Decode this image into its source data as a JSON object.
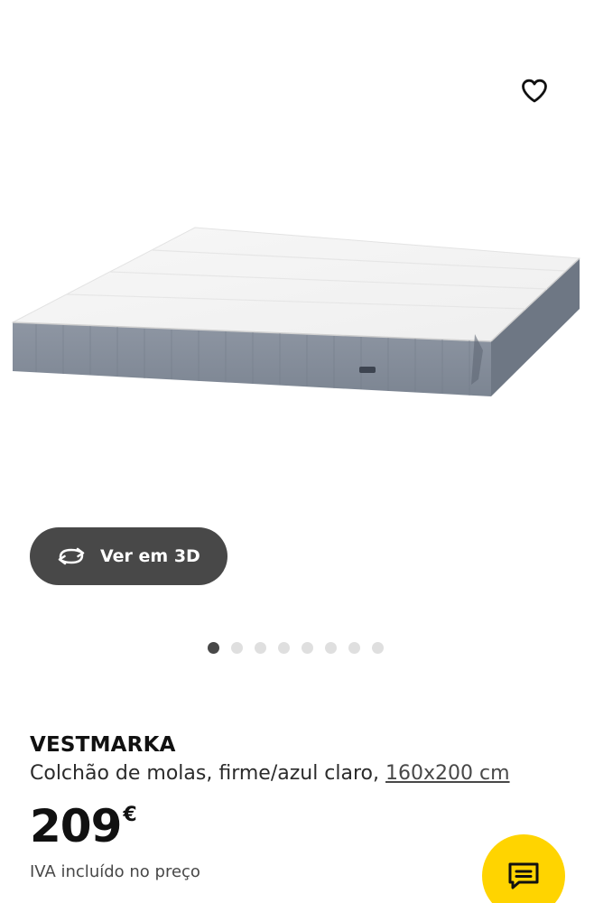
{
  "gallery": {
    "view_3d_label": "Ver em 3D",
    "image_count": 8,
    "active_index": 0
  },
  "product": {
    "name": "VESTMARKA",
    "description": "Colchão de molas, firme/azul claro,",
    "size": "160x200 cm",
    "price": "209",
    "currency": "€",
    "vat_note": "IVA incluído no preço"
  },
  "icons": {
    "favorite": "heart-outline-icon",
    "view_3d": "rotate-3d-icon",
    "chat": "chat-bubble-icon"
  },
  "colors": {
    "accent_yellow": "#ffd400",
    "button_dark": "#484848",
    "dot_inactive": "#dfdfdf"
  }
}
